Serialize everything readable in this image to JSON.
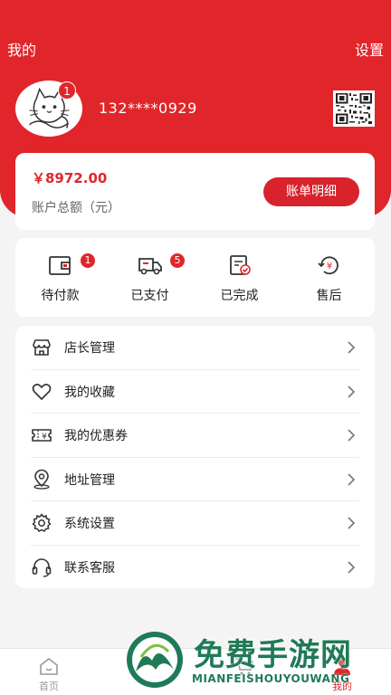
{
  "header": {
    "title": "我的",
    "settings_label": "设置",
    "brand_color": "#e0262b"
  },
  "profile": {
    "phone": "132****0929",
    "avatar_badge": "1"
  },
  "balance": {
    "amount": "￥8972.00",
    "label": "账户总额（元）",
    "bill_button": "账单明细"
  },
  "orders": [
    {
      "label": "待付款",
      "icon": "wallet-icon",
      "badge": "1"
    },
    {
      "label": "已支付",
      "icon": "truck-icon",
      "badge": "5"
    },
    {
      "label": "已完成",
      "icon": "clipboard-check-icon",
      "badge": ""
    },
    {
      "label": "售后",
      "icon": "refund-icon",
      "badge": ""
    }
  ],
  "menu": [
    {
      "label": "店长管理",
      "icon": "store-icon"
    },
    {
      "label": "我的收藏",
      "icon": "heart-icon"
    },
    {
      "label": "我的优惠券",
      "icon": "coupon-icon"
    },
    {
      "label": "地址管理",
      "icon": "location-icon"
    },
    {
      "label": "系统设置",
      "icon": "gear-icon"
    },
    {
      "label": "联系客服",
      "icon": "headset-icon"
    }
  ],
  "tabbar": [
    {
      "label": "首页",
      "icon": "home-icon"
    },
    {
      "label": "",
      "icon": "category-icon"
    },
    {
      "label": "",
      "icon": "cart-icon"
    },
    {
      "label": "我的",
      "icon": "user-icon"
    }
  ],
  "watermark": {
    "title": "免费手游网",
    "subtitle": "MIANFEISHOUYOUWANG"
  }
}
